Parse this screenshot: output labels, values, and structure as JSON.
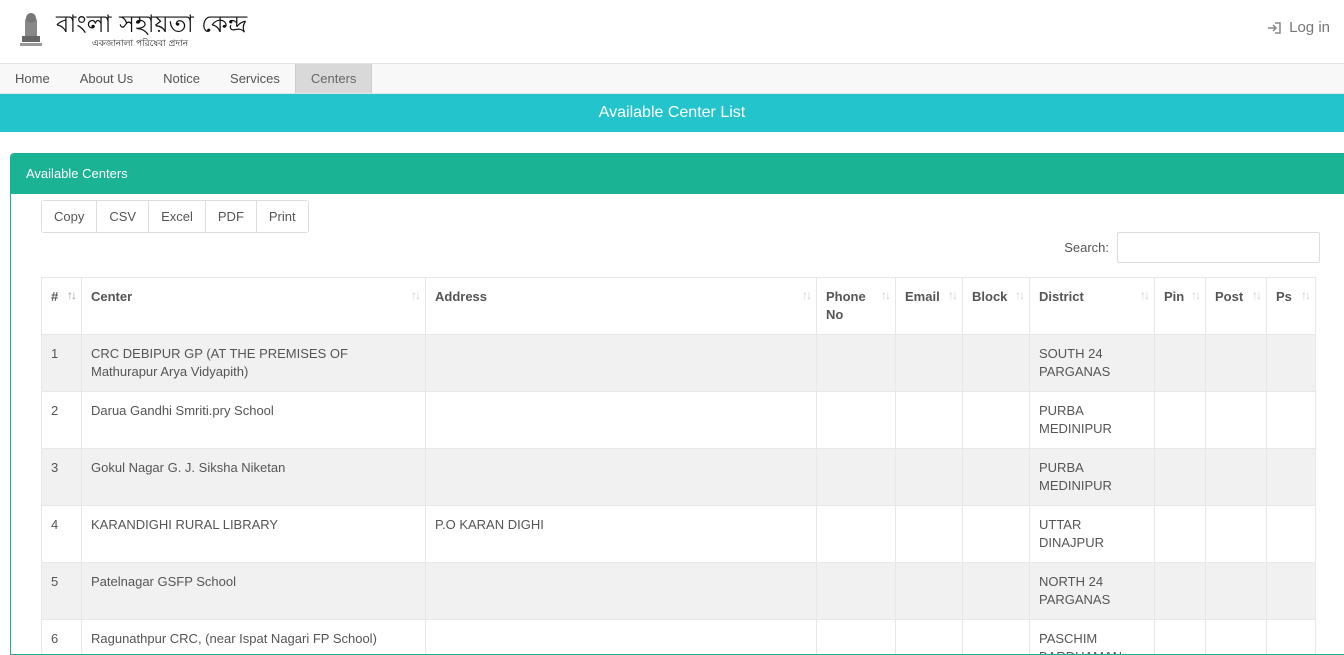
{
  "header": {
    "logo_title": "বাংলা সহায়তা কেন্দ্র",
    "logo_subtitle": "একজানালা পরিষেবা প্রদান",
    "login_label": "Log in"
  },
  "nav": {
    "items": [
      {
        "label": "Home"
      },
      {
        "label": "About Us"
      },
      {
        "label": "Notice"
      },
      {
        "label": "Services"
      },
      {
        "label": "Centers"
      }
    ],
    "active": "Centers"
  },
  "banner": {
    "title": "Available Center List"
  },
  "panel": {
    "heading": "Available Centers",
    "buttons": [
      "Copy",
      "CSV",
      "Excel",
      "PDF",
      "Print"
    ],
    "search_label": "Search:",
    "search_value": ""
  },
  "table": {
    "columns": [
      "#",
      "Center",
      "Address",
      "Phone No",
      "Email",
      "Block",
      "District",
      "Pin",
      "Post",
      "Ps"
    ],
    "rows": [
      {
        "num": "1",
        "center": "CRC DEBIPUR GP (AT THE PREMISES OF Mathurapur Arya Vidyapith)",
        "address": "",
        "phone": "",
        "email": "",
        "block": "",
        "district": "SOUTH 24 PARGANAS",
        "pin": "",
        "post": "",
        "ps": ""
      },
      {
        "num": "2",
        "center": "Darua Gandhi Smriti.pry School",
        "address": "",
        "phone": "",
        "email": "",
        "block": "",
        "district": "PURBA MEDINIPUR",
        "pin": "",
        "post": "",
        "ps": ""
      },
      {
        "num": "3",
        "center": "Gokul Nagar G. J. Siksha Niketan",
        "address": "",
        "phone": "",
        "email": "",
        "block": "",
        "district": "PURBA MEDINIPUR",
        "pin": "",
        "post": "",
        "ps": ""
      },
      {
        "num": "4",
        "center": "KARANDIGHI RURAL LIBRARY",
        "address": "P.O KARAN DIGHI",
        "phone": "",
        "email": "",
        "block": "",
        "district": "UTTAR DINAJPUR",
        "pin": "",
        "post": "",
        "ps": ""
      },
      {
        "num": "5",
        "center": "Patelnagar GSFP School",
        "address": "",
        "phone": "",
        "email": "",
        "block": "",
        "district": "NORTH 24 PARGANAS",
        "pin": "",
        "post": "",
        "ps": ""
      },
      {
        "num": "6",
        "center": "Ragunathpur CRC, (near Ispat Nagari FP School)",
        "address": "",
        "phone": "",
        "email": "",
        "block": "",
        "district": "PASCHIM BARDHAMAN",
        "pin": "",
        "post": "",
        "ps": ""
      }
    ]
  },
  "colors": {
    "banner": "#23c4cb",
    "panel_heading": "#1ab394"
  }
}
